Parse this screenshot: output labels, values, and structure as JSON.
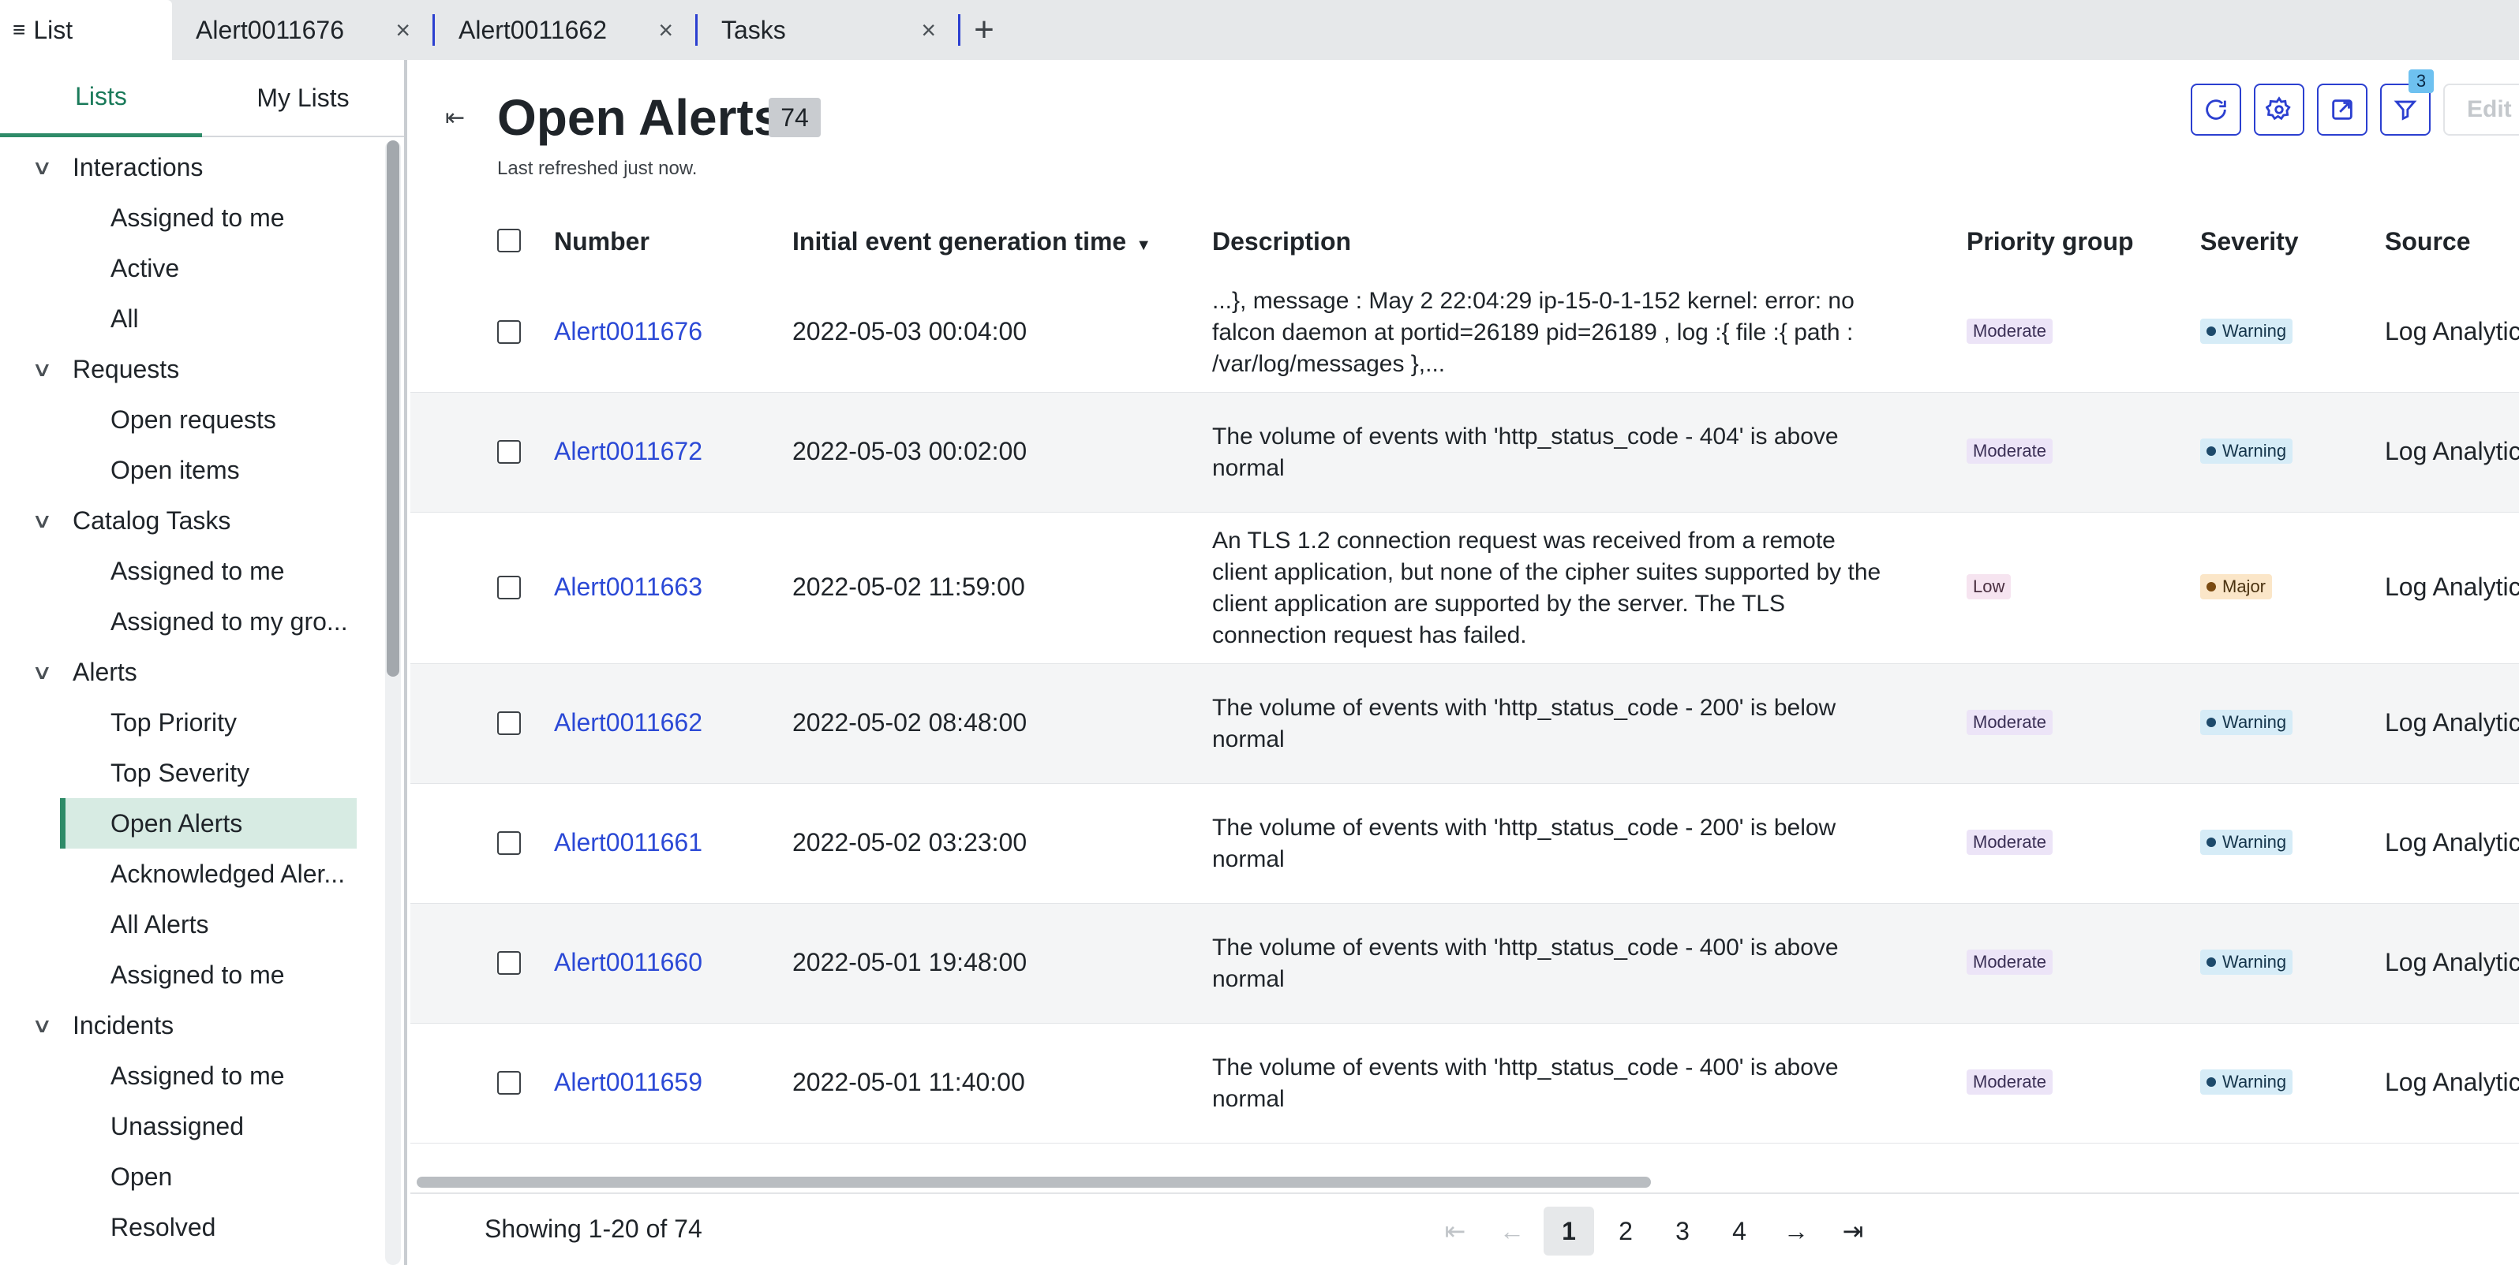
{
  "tabs": {
    "list_label": "List",
    "records": [
      {
        "label": "Alert0011676"
      },
      {
        "label": "Alert0011662"
      },
      {
        "label": "Tasks"
      }
    ],
    "add_label": "+",
    "close_glyph": "×"
  },
  "sidebar": {
    "tab_lists": "Lists",
    "tab_my_lists": "My Lists",
    "groups": [
      {
        "label": "Interactions",
        "items": [
          "Assigned to me",
          "Active",
          "All"
        ]
      },
      {
        "label": "Requests",
        "items": [
          "Open requests",
          "Open items"
        ]
      },
      {
        "label": "Catalog Tasks",
        "items": [
          "Assigned to me",
          "Assigned to my gro..."
        ]
      },
      {
        "label": "Alerts",
        "items": [
          "Top Priority",
          "Top Severity",
          "Open Alerts",
          "Acknowledged Aler...",
          "All Alerts",
          "Assigned to me"
        ]
      },
      {
        "label": "Incidents",
        "items": [
          "Assigned to me",
          "Unassigned",
          "Open",
          "Resolved"
        ]
      }
    ],
    "selected": "Open Alerts"
  },
  "main": {
    "title": "Open Alerts",
    "count": "74",
    "refreshed": "Last refreshed just now.",
    "filter_count": "3",
    "edit_label": "Edit",
    "columns": {
      "number": "Number",
      "time": "Initial event generation time",
      "description": "Description",
      "priority": "Priority group",
      "severity": "Severity",
      "source": "Source"
    },
    "rows": [
      {
        "number": "Alert0011676",
        "time": "2022-05-03 00:04:00",
        "description": "...}, message : May 2 22:04:29 ip-15-0-1-152 kernel: error: no falcon daemon at portid=26189 pid=26189 , log :{ file :{ path : /var/log/messages },...",
        "priority": "Moderate",
        "severity": "Warning",
        "source": "Log Analytics"
      },
      {
        "number": "Alert0011672",
        "time": "2022-05-03 00:02:00",
        "description": "The volume of events with 'http_status_code - 404' is above normal",
        "priority": "Moderate",
        "severity": "Warning",
        "source": "Log Analytics"
      },
      {
        "number": "Alert0011663",
        "time": "2022-05-02 11:59:00",
        "description": "An TLS 1.2 connection request was received from a remote client application, but none of the cipher suites supported by the client application are supported by the server. The TLS connection request has failed.",
        "priority": "Low",
        "severity": "Major",
        "source": "Log Analytics"
      },
      {
        "number": "Alert0011662",
        "time": "2022-05-02 08:48:00",
        "description": "The volume of events with 'http_status_code - 200' is below normal",
        "priority": "Moderate",
        "severity": "Warning",
        "source": "Log Analytics"
      },
      {
        "number": "Alert0011661",
        "time": "2022-05-02 03:23:00",
        "description": "The volume of events with 'http_status_code - 200' is below normal",
        "priority": "Moderate",
        "severity": "Warning",
        "source": "Log Analytics"
      },
      {
        "number": "Alert0011660",
        "time": "2022-05-01 19:48:00",
        "description": "The volume of events with 'http_status_code - 400' is above normal",
        "priority": "Moderate",
        "severity": "Warning",
        "source": "Log Analytics"
      },
      {
        "number": "Alert0011659",
        "time": "2022-05-01 11:40:00",
        "description": "The volume of events with 'http_status_code - 400' is above normal",
        "priority": "Moderate",
        "severity": "Warning",
        "source": "Log Analytics"
      }
    ]
  },
  "footer": {
    "showing": "Showing 1-20 of 74",
    "pages": [
      "1",
      "2",
      "3",
      "4"
    ],
    "current_page": "1"
  },
  "colors": {
    "accent": "#2b3fd0",
    "selected_green": "#2e8b68",
    "link_blue": "#2b49d6"
  }
}
